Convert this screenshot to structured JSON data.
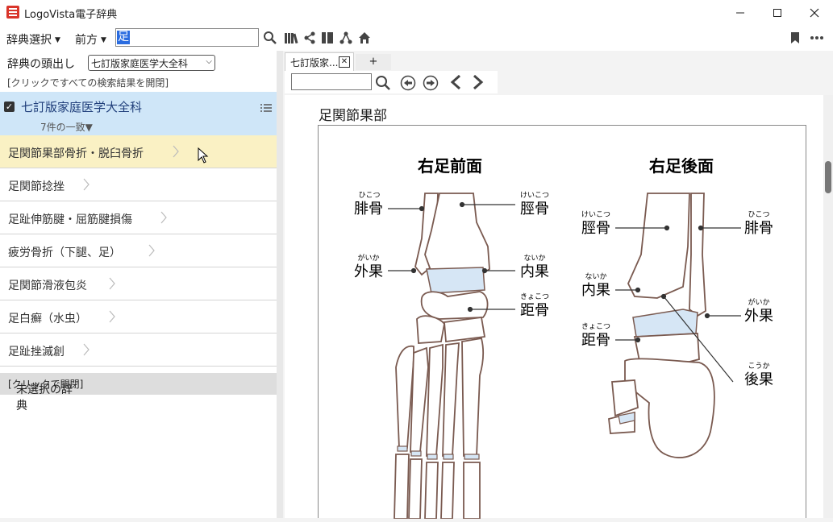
{
  "window": {
    "title": "LogoVista電子辞典"
  },
  "toolbar": {
    "dict_select": "辞典選択",
    "direction": "前方",
    "search_value": "足"
  },
  "left": {
    "index_label": "辞典の頭出し",
    "index_select": "七訂版家庭医学大全科",
    "open_all": "[クリックですべての検索結果を開閉]",
    "dict_name": "七訂版家庭医学大全科",
    "dict_count": "7件の一致▼",
    "entries": [
      "足関節果部骨折・脱臼骨折",
      "足関節捻挫",
      "足趾伸筋腱・屈筋腱損傷",
      "疲労骨折（下腿、足）",
      "足関節滑液包炎",
      "足白癬（水虫）",
      "足趾挫滅創"
    ],
    "unselected_label": "未選択の辞典",
    "unselected_hint": "[クリックで開閉]"
  },
  "right": {
    "tab_label": "七訂版家...",
    "tab_add": "+",
    "heading": "足関節果部"
  },
  "figure": {
    "front": {
      "title": "右足前面",
      "labels": [
        {
          "text": "腓骨",
          "ruby": "ひこつ"
        },
        {
          "text": "脛骨",
          "ruby": "けいこつ"
        },
        {
          "text": "外果",
          "ruby": "がいか"
        },
        {
          "text": "内果",
          "ruby": "ないか"
        },
        {
          "text": "距骨",
          "ruby": "きょこつ"
        }
      ]
    },
    "back": {
      "title": "右足後面",
      "labels": [
        {
          "text": "脛骨",
          "ruby": "けいこつ"
        },
        {
          "text": "腓骨",
          "ruby": "ひこつ"
        },
        {
          "text": "内果",
          "ruby": "ないか"
        },
        {
          "text": "外果",
          "ruby": "がいか"
        },
        {
          "text": "距骨",
          "ruby": "きょこつ"
        },
        {
          "text": "後果",
          "ruby": "こうか"
        }
      ]
    }
  },
  "colors": {
    "accent": "#2a6ce0",
    "selected_entry": "#faf1c4",
    "dict_header": "#cfe6f8",
    "cartilage": "#d6e6f5",
    "bone_outline": "#7a5a50"
  }
}
